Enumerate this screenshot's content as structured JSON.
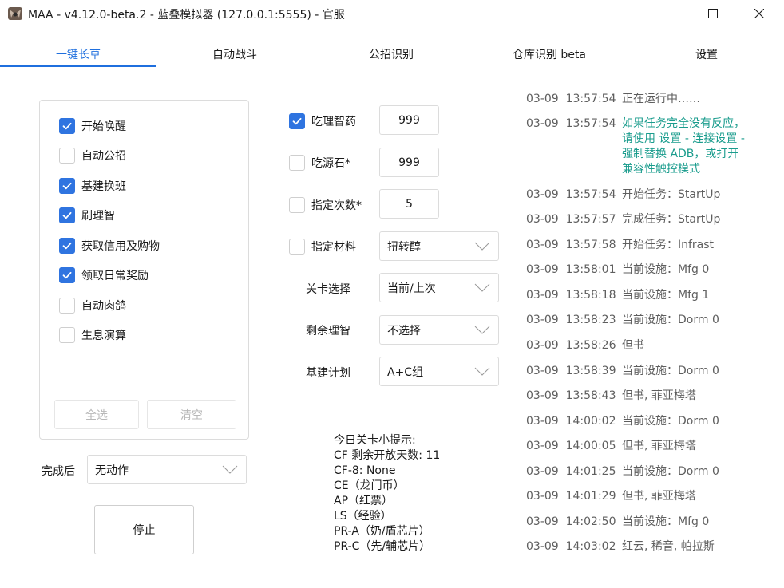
{
  "window": {
    "title": "MAA - v4.12.0-beta.2 - 蓝叠模拟器 (127.0.0.1:5555) - 官服",
    "icons": [
      "app-icon",
      "minimize-icon",
      "maximize-icon",
      "close-icon"
    ]
  },
  "tabs": [
    {
      "label": "一键长草",
      "active": true
    },
    {
      "label": "自动战斗",
      "active": false
    },
    {
      "label": "公招识别",
      "active": false
    },
    {
      "label": "仓库识别 beta",
      "active": false
    },
    {
      "label": "设置",
      "active": false
    }
  ],
  "tasks": [
    {
      "label": "开始唤醒",
      "checked": true
    },
    {
      "label": "自动公招",
      "checked": false
    },
    {
      "label": "基建换班",
      "checked": true
    },
    {
      "label": "刷理智",
      "checked": true
    },
    {
      "label": "获取信用及购物",
      "checked": true
    },
    {
      "label": "领取日常奖励",
      "checked": true
    },
    {
      "label": "自动肉鸽",
      "checked": false
    },
    {
      "label": "生息演算",
      "checked": false
    }
  ],
  "task_buttons": {
    "select_all": "全选",
    "clear": "清空"
  },
  "after_finish": {
    "label": "完成后",
    "value": "无动作"
  },
  "stop_button": "停止",
  "options": {
    "medicine": {
      "label": "吃理智药",
      "checked": true,
      "value": "999"
    },
    "stone": {
      "label": "吃源石*",
      "checked": false,
      "value": "999"
    },
    "times": {
      "label": "指定次数*",
      "checked": false,
      "value": "5"
    },
    "material": {
      "label": "指定材料",
      "checked": false,
      "value": "扭转醇"
    },
    "stage": {
      "label": "关卡选择",
      "value": "当前/上次"
    },
    "remaining": {
      "label": "剩余理智",
      "value": "不选择"
    },
    "plan": {
      "label": "基建计划",
      "value": "A+C组"
    }
  },
  "tips": [
    "今日关卡小提示:",
    "CF 剩余开放天数: 11",
    "CF-8: None",
    "CE（龙门币）",
    "AP（红票）",
    "LS（经验）",
    "PR-A（奶/盾芯片）",
    "PR-C（先/辅芯片）"
  ],
  "log": [
    {
      "date": "03-09",
      "time": "13:57:54",
      "msg": "正在运行中……",
      "note": false
    },
    {
      "date": "03-09",
      "time": "13:57:54",
      "msg": "如果任务完全没有反应，\n请使用 设置 - 连接设置 -\n强制替换 ADB，或打开\n兼容性触控模式",
      "note": true
    },
    {
      "date": "03-09",
      "time": "13:57:54",
      "msg": "开始任务：StartUp",
      "note": false
    },
    {
      "date": "03-09",
      "time": "13:57:57",
      "msg": "完成任务：StartUp",
      "note": false
    },
    {
      "date": "03-09",
      "time": "13:57:58",
      "msg": "开始任务：Infrast",
      "note": false
    },
    {
      "date": "03-09",
      "time": "13:58:01",
      "msg": "当前设施：Mfg 0",
      "note": false
    },
    {
      "date": "03-09",
      "time": "13:58:18",
      "msg": "当前设施：Mfg 1",
      "note": false
    },
    {
      "date": "03-09",
      "time": "13:58:23",
      "msg": "当前设施：Dorm 0",
      "note": false
    },
    {
      "date": "03-09",
      "time": "13:58:26",
      "msg": "但书",
      "note": false
    },
    {
      "date": "03-09",
      "time": "13:58:39",
      "msg": "当前设施：Dorm 0",
      "note": false
    },
    {
      "date": "03-09",
      "time": "13:58:43",
      "msg": "但书, 菲亚梅塔",
      "note": false
    },
    {
      "date": "03-09",
      "time": "14:00:02",
      "msg": "当前设施：Dorm 0",
      "note": false
    },
    {
      "date": "03-09",
      "time": "14:00:05",
      "msg": "但书, 菲亚梅塔",
      "note": false
    },
    {
      "date": "03-09",
      "time": "14:01:25",
      "msg": "当前设施：Dorm 0",
      "note": false
    },
    {
      "date": "03-09",
      "time": "14:01:29",
      "msg": "但书, 菲亚梅塔",
      "note": false
    },
    {
      "date": "03-09",
      "time": "14:02:50",
      "msg": "当前设施：Mfg 0",
      "note": false
    },
    {
      "date": "03-09",
      "time": "14:03:02",
      "msg": "红云, 稀音, 帕拉斯",
      "note": false
    }
  ],
  "colors": {
    "accent": "#1f6fde",
    "checkbox": "#2f74e0",
    "note": "#1a9c8d",
    "log_text": "#5e5e5e"
  }
}
